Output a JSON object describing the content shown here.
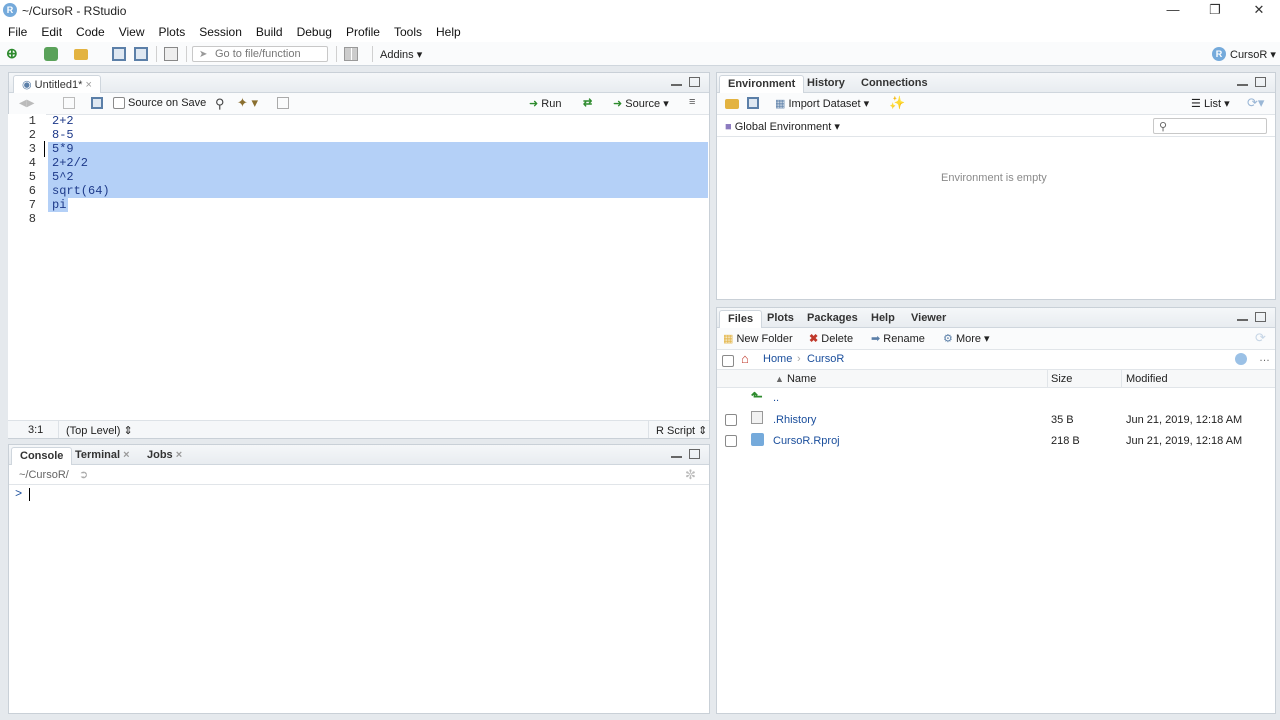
{
  "window": {
    "title": "~/CursoR - RStudio",
    "logo_letter": "R"
  },
  "menu": [
    "File",
    "Edit",
    "Code",
    "View",
    "Plots",
    "Session",
    "Build",
    "Debug",
    "Profile",
    "Tools",
    "Help"
  ],
  "toolbar": {
    "goto_placeholder": "Go to file/function",
    "addins": "Addins",
    "project": "CursoR"
  },
  "editor": {
    "tab": "Untitled1*",
    "source_on_save": "Source on Save",
    "run": "Run",
    "source": "Source",
    "lines": [
      "2+2",
      "8-5",
      "5*9",
      "2+2/2",
      "5^2",
      "sqrt(64)",
      "pi",
      ""
    ],
    "status_pos": "3:1",
    "status_scope": "(Top Level)",
    "status_type": "R Script"
  },
  "console": {
    "tabs": [
      "Console",
      "Terminal",
      "Jobs"
    ],
    "path": "~/CursoR/",
    "prompt": ">"
  },
  "env": {
    "tabs": [
      "Environment",
      "History",
      "Connections"
    ],
    "import": "Import Dataset",
    "list": "List",
    "global": "Global Environment",
    "empty": "Environment is empty"
  },
  "files": {
    "tabs": [
      "Files",
      "Plots",
      "Packages",
      "Help",
      "Viewer"
    ],
    "new_folder": "New Folder",
    "delete": "Delete",
    "rename": "Rename",
    "more": "More",
    "breadcrumb": [
      "Home",
      "CursoR"
    ],
    "columns": {
      "name": "Name",
      "size": "Size",
      "modified": "Modified"
    },
    "parent": "..",
    "rows": [
      {
        "name": ".Rhistory",
        "size": "35 B",
        "modified": "Jun 21, 2019, 12:18 AM"
      },
      {
        "name": "CursoR.Rproj",
        "size": "218 B",
        "modified": "Jun 21, 2019, 12:18 AM"
      }
    ]
  }
}
